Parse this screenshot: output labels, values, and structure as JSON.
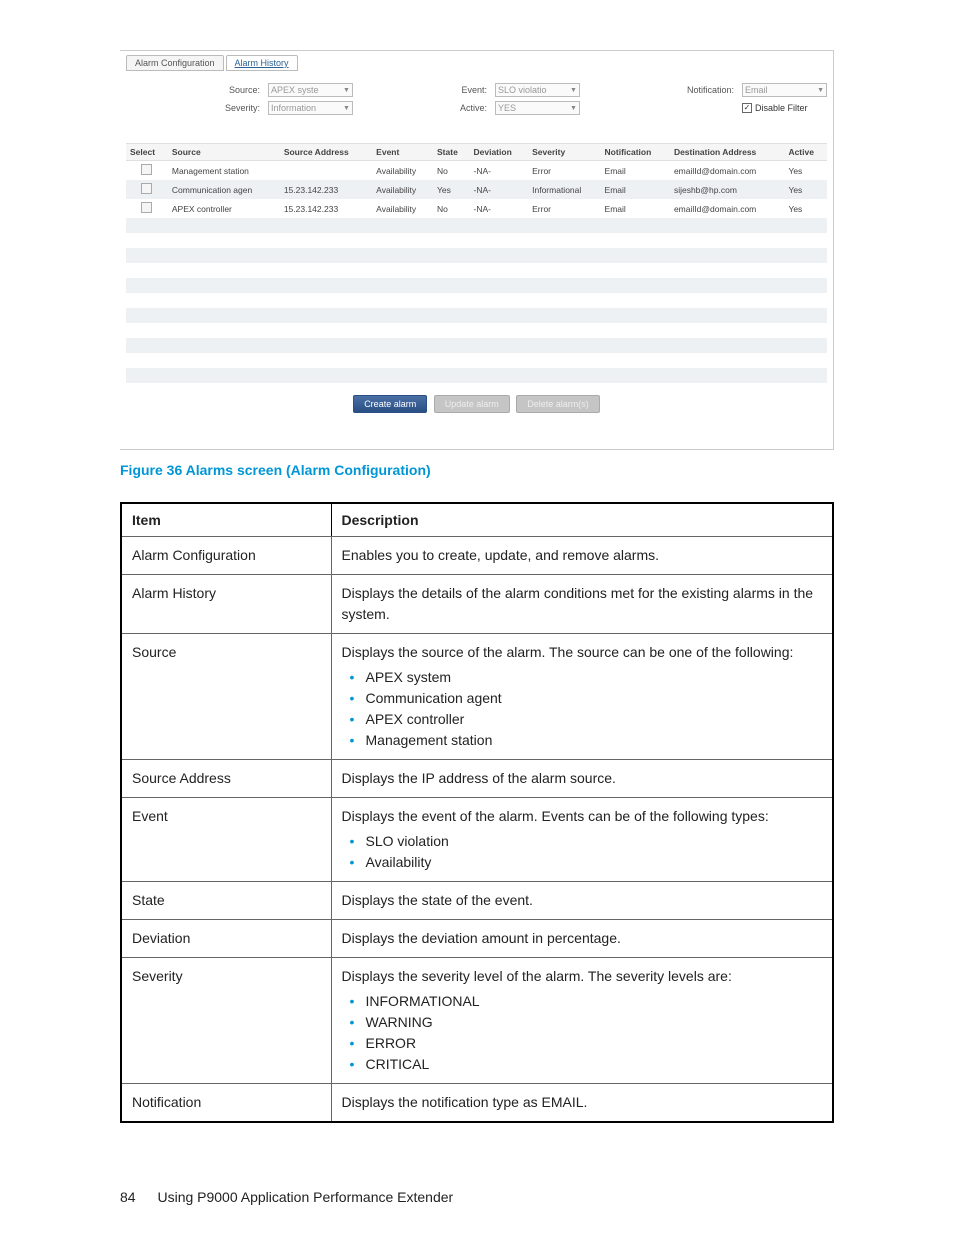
{
  "screenshot": {
    "tabs": [
      "Alarm Configuration",
      "Alarm History"
    ],
    "filters": [
      {
        "label": "Source:",
        "value": "APEX syste"
      },
      {
        "label": "Event:",
        "value": "SLO violatio"
      },
      {
        "label": "Notification:",
        "value": "Email"
      },
      {
        "label": "Severity:",
        "value": "Information"
      },
      {
        "label": "Active:",
        "value": "YES"
      }
    ],
    "disable_filter_label": "Disable Filter",
    "grid_headers": [
      "Select",
      "Source",
      "Source Address",
      "Event",
      "State",
      "Deviation",
      "Severity",
      "Notification",
      "Destination Address",
      "Active"
    ],
    "grid_rows": [
      {
        "source": "Management station",
        "addr": "",
        "event": "Availability",
        "state": "No",
        "dev": "-NA-",
        "sev": "Error",
        "notif": "Email",
        "dest": "emailId@domain.com",
        "active": "Yes"
      },
      {
        "source": "Communication agen",
        "addr": "15.23.142.233",
        "event": "Availability",
        "state": "Yes",
        "dev": "-NA-",
        "sev": "Informational",
        "notif": "Email",
        "dest": "sijeshb@hp.com",
        "active": "Yes"
      },
      {
        "source": "APEX controller",
        "addr": "15.23.142.233",
        "event": "Availability",
        "state": "No",
        "dev": "-NA-",
        "sev": "Error",
        "notif": "Email",
        "dest": "emailId@domain.com",
        "active": "Yes"
      }
    ],
    "buttons": {
      "create": "Create alarm",
      "update": "Update alarm",
      "delete": "Delete alarm(s)"
    }
  },
  "figure_caption": "Figure 36 Alarms screen (Alarm Configuration)",
  "table_headers": {
    "item": "Item",
    "desc": "Description"
  },
  "rows": [
    {
      "item": "Alarm Configuration",
      "desc": "Enables you to create, update, and remove alarms."
    },
    {
      "item": "Alarm History",
      "desc": "Displays the details of the alarm conditions met for the existing alarms in the system."
    },
    {
      "item": "Source",
      "desc": "Displays the source of the alarm. The source can be one of the following:",
      "bullets": [
        "APEX system",
        "Communication agent",
        "APEX controller",
        "Management station"
      ]
    },
    {
      "item": "Source Address",
      "desc": "Displays the IP address of the alarm source."
    },
    {
      "item": "Event",
      "desc": "Displays the event of the alarm. Events can be of the following types:",
      "bullets": [
        "SLO violation",
        "Availability"
      ]
    },
    {
      "item": "State",
      "desc": "Displays the state of the event."
    },
    {
      "item": "Deviation",
      "desc": "Displays the deviation amount in percentage."
    },
    {
      "item": "Severity",
      "desc": "Displays the severity level of the alarm. The severity levels are:",
      "bullets": [
        "INFORMATIONAL",
        "WARNING",
        "ERROR",
        "CRITICAL"
      ]
    },
    {
      "item": "Notification",
      "desc": "Displays the notification type as EMAIL."
    }
  ],
  "footer": {
    "page": "84",
    "title": "Using P9000 Application Performance Extender"
  }
}
